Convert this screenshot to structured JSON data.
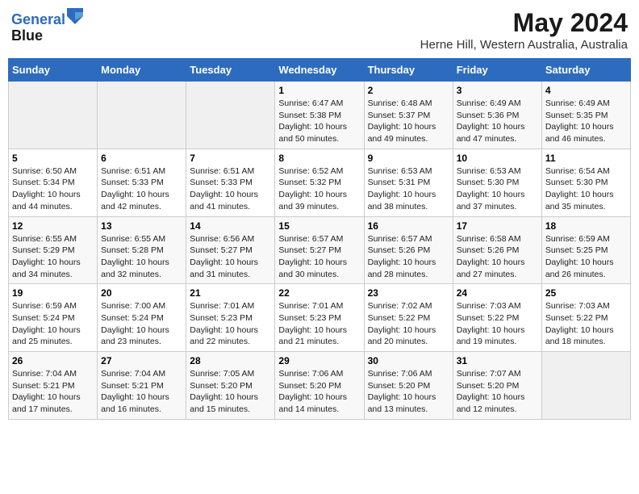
{
  "header": {
    "logo_line1": "General",
    "logo_line2": "Blue",
    "title": "May 2024",
    "subtitle": "Herne Hill, Western Australia, Australia"
  },
  "calendar": {
    "weekdays": [
      "Sunday",
      "Monday",
      "Tuesday",
      "Wednesday",
      "Thursday",
      "Friday",
      "Saturday"
    ],
    "weeks": [
      [
        {
          "day": "",
          "empty": true
        },
        {
          "day": "",
          "empty": true
        },
        {
          "day": "",
          "empty": true
        },
        {
          "day": "1",
          "sunrise": "6:47 AM",
          "sunset": "5:38 PM",
          "daylight": "10 hours and 50 minutes."
        },
        {
          "day": "2",
          "sunrise": "6:48 AM",
          "sunset": "5:37 PM",
          "daylight": "10 hours and 49 minutes."
        },
        {
          "day": "3",
          "sunrise": "6:49 AM",
          "sunset": "5:36 PM",
          "daylight": "10 hours and 47 minutes."
        },
        {
          "day": "4",
          "sunrise": "6:49 AM",
          "sunset": "5:35 PM",
          "daylight": "10 hours and 46 minutes."
        }
      ],
      [
        {
          "day": "5",
          "sunrise": "6:50 AM",
          "sunset": "5:34 PM",
          "daylight": "10 hours and 44 minutes."
        },
        {
          "day": "6",
          "sunrise": "6:51 AM",
          "sunset": "5:33 PM",
          "daylight": "10 hours and 42 minutes."
        },
        {
          "day": "7",
          "sunrise": "6:51 AM",
          "sunset": "5:33 PM",
          "daylight": "10 hours and 41 minutes."
        },
        {
          "day": "8",
          "sunrise": "6:52 AM",
          "sunset": "5:32 PM",
          "daylight": "10 hours and 39 minutes."
        },
        {
          "day": "9",
          "sunrise": "6:53 AM",
          "sunset": "5:31 PM",
          "daylight": "10 hours and 38 minutes."
        },
        {
          "day": "10",
          "sunrise": "6:53 AM",
          "sunset": "5:30 PM",
          "daylight": "10 hours and 37 minutes."
        },
        {
          "day": "11",
          "sunrise": "6:54 AM",
          "sunset": "5:30 PM",
          "daylight": "10 hours and 35 minutes."
        }
      ],
      [
        {
          "day": "12",
          "sunrise": "6:55 AM",
          "sunset": "5:29 PM",
          "daylight": "10 hours and 34 minutes."
        },
        {
          "day": "13",
          "sunrise": "6:55 AM",
          "sunset": "5:28 PM",
          "daylight": "10 hours and 32 minutes."
        },
        {
          "day": "14",
          "sunrise": "6:56 AM",
          "sunset": "5:27 PM",
          "daylight": "10 hours and 31 minutes."
        },
        {
          "day": "15",
          "sunrise": "6:57 AM",
          "sunset": "5:27 PM",
          "daylight": "10 hours and 30 minutes."
        },
        {
          "day": "16",
          "sunrise": "6:57 AM",
          "sunset": "5:26 PM",
          "daylight": "10 hours and 28 minutes."
        },
        {
          "day": "17",
          "sunrise": "6:58 AM",
          "sunset": "5:26 PM",
          "daylight": "10 hours and 27 minutes."
        },
        {
          "day": "18",
          "sunrise": "6:59 AM",
          "sunset": "5:25 PM",
          "daylight": "10 hours and 26 minutes."
        }
      ],
      [
        {
          "day": "19",
          "sunrise": "6:59 AM",
          "sunset": "5:24 PM",
          "daylight": "10 hours and 25 minutes."
        },
        {
          "day": "20",
          "sunrise": "7:00 AM",
          "sunset": "5:24 PM",
          "daylight": "10 hours and 23 minutes."
        },
        {
          "day": "21",
          "sunrise": "7:01 AM",
          "sunset": "5:23 PM",
          "daylight": "10 hours and 22 minutes."
        },
        {
          "day": "22",
          "sunrise": "7:01 AM",
          "sunset": "5:23 PM",
          "daylight": "10 hours and 21 minutes."
        },
        {
          "day": "23",
          "sunrise": "7:02 AM",
          "sunset": "5:22 PM",
          "daylight": "10 hours and 20 minutes."
        },
        {
          "day": "24",
          "sunrise": "7:03 AM",
          "sunset": "5:22 PM",
          "daylight": "10 hours and 19 minutes."
        },
        {
          "day": "25",
          "sunrise": "7:03 AM",
          "sunset": "5:22 PM",
          "daylight": "10 hours and 18 minutes."
        }
      ],
      [
        {
          "day": "26",
          "sunrise": "7:04 AM",
          "sunset": "5:21 PM",
          "daylight": "10 hours and 17 minutes."
        },
        {
          "day": "27",
          "sunrise": "7:04 AM",
          "sunset": "5:21 PM",
          "daylight": "10 hours and 16 minutes."
        },
        {
          "day": "28",
          "sunrise": "7:05 AM",
          "sunset": "5:20 PM",
          "daylight": "10 hours and 15 minutes."
        },
        {
          "day": "29",
          "sunrise": "7:06 AM",
          "sunset": "5:20 PM",
          "daylight": "10 hours and 14 minutes."
        },
        {
          "day": "30",
          "sunrise": "7:06 AM",
          "sunset": "5:20 PM",
          "daylight": "10 hours and 13 minutes."
        },
        {
          "day": "31",
          "sunrise": "7:07 AM",
          "sunset": "5:20 PM",
          "daylight": "10 hours and 12 minutes."
        },
        {
          "day": "",
          "empty": true
        }
      ]
    ]
  }
}
